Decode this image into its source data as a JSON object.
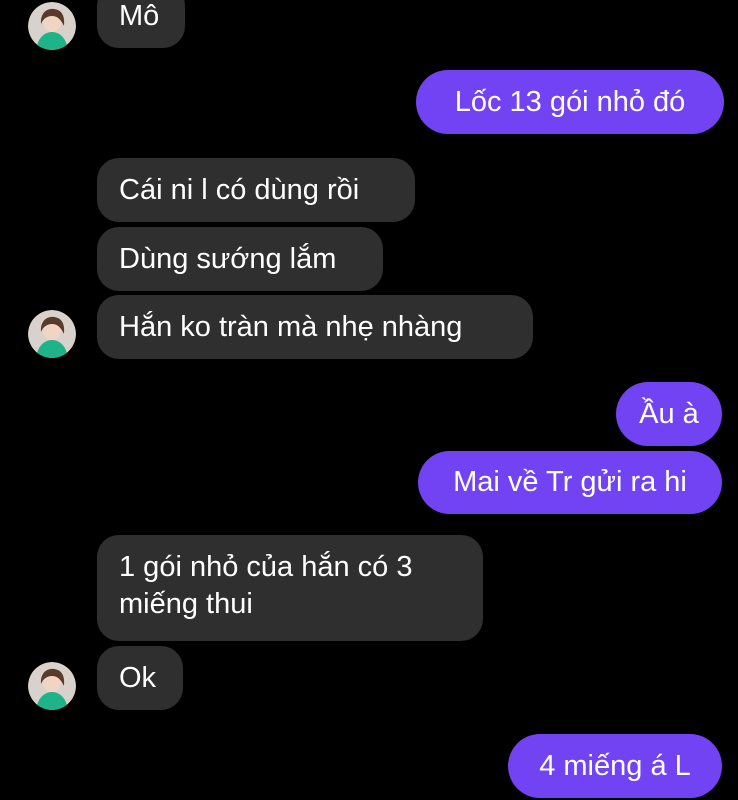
{
  "conversation": {
    "messages": [
      {
        "side": "in",
        "text": "Mô"
      },
      {
        "side": "out",
        "text": "Lốc 13 gói nhỏ đó"
      },
      {
        "side": "in",
        "text": "Cái ni l có dùng rồi"
      },
      {
        "side": "in",
        "text": "Dùng sướng lắm"
      },
      {
        "side": "in",
        "text": "Hắn ko tràn mà nhẹ nhàng"
      },
      {
        "side": "out",
        "text": "Ầu à"
      },
      {
        "side": "out",
        "text": "Mai về Tr gửi ra hi"
      },
      {
        "side": "in",
        "text": "1 gói nhỏ của hắn có 3 miếng thui"
      },
      {
        "side": "in",
        "text": "Ok"
      },
      {
        "side": "out",
        "text": "4 miếng á L"
      }
    ]
  },
  "colors": {
    "background": "#000000",
    "incoming_bubble": "#2f2f30",
    "outgoing_bubble": "#7243f2",
    "text": "#ffffff"
  },
  "icons": {
    "avatar": "contact-avatar-icon"
  }
}
